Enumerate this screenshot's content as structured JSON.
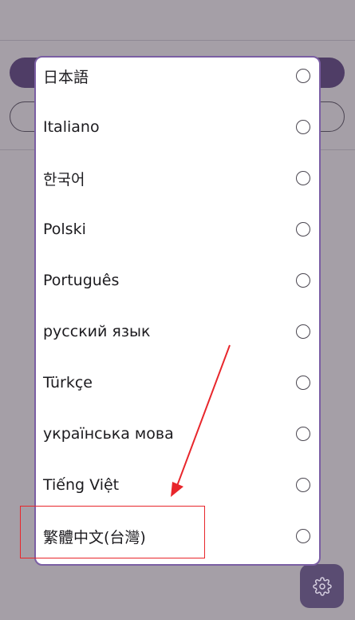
{
  "languages": [
    {
      "label": "日本語",
      "selected": false
    },
    {
      "label": "Italiano",
      "selected": false
    },
    {
      "label": "한국어",
      "selected": false
    },
    {
      "label": "Polski",
      "selected": false
    },
    {
      "label": "Português",
      "selected": false
    },
    {
      "label": "русский язык",
      "selected": false
    },
    {
      "label": "Türkçe",
      "selected": false
    },
    {
      "label": "українська мова",
      "selected": false
    },
    {
      "label": "Tiếng Việt",
      "selected": false
    },
    {
      "label": "繁體中文(台灣)",
      "selected": false
    }
  ],
  "icons": {
    "settings": "gear-icon"
  },
  "colors": {
    "accent": "#7a5ea3",
    "annotation": "#e8262b",
    "scrim": "#a59fa7"
  }
}
